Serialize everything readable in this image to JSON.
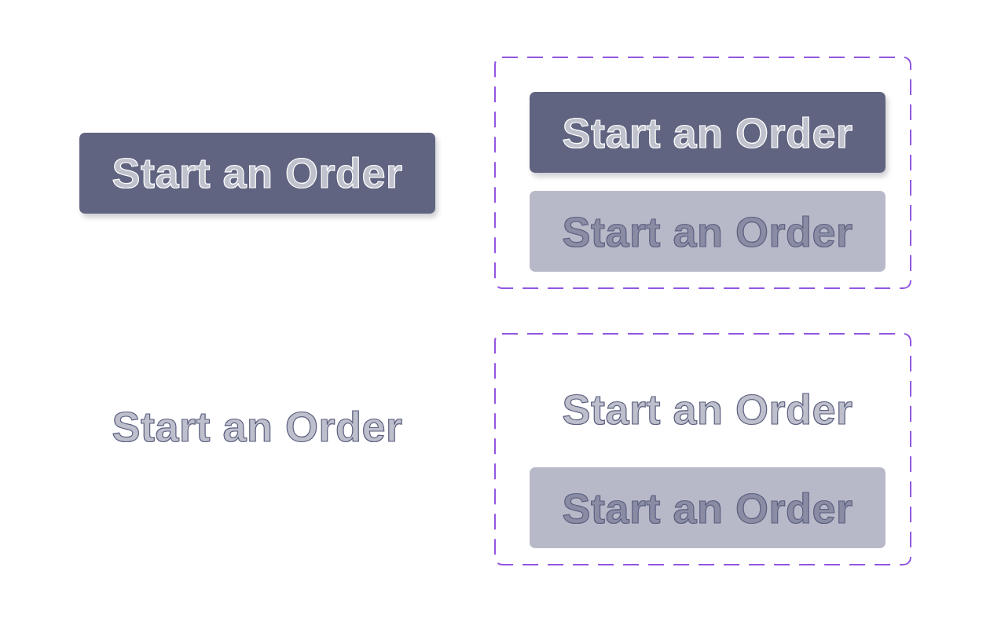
{
  "rows": [
    {
      "example": {
        "kind": "filled",
        "label": "Start an Order"
      },
      "variants": [
        {
          "kind": "filled",
          "label": "Start an Order"
        },
        {
          "kind": "tinted",
          "label": "Start an Order"
        }
      ]
    },
    {
      "example": {
        "kind": "text",
        "label": "Start an Order"
      },
      "variants": [
        {
          "kind": "text",
          "label": "Start an Order"
        },
        {
          "kind": "tinted",
          "label": "Start an Order"
        }
      ]
    }
  ]
}
